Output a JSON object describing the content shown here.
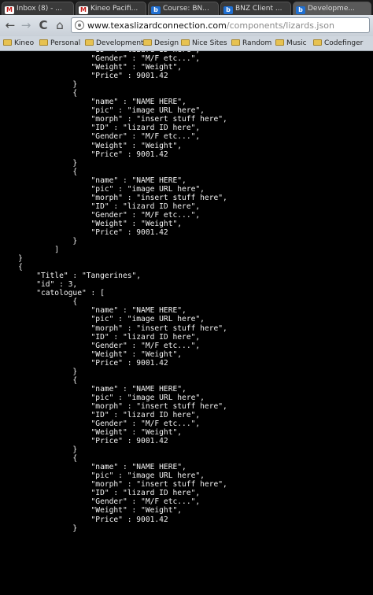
{
  "tabs": [
    {
      "title": "Inbox (8) - ...",
      "icon": "gmail-icon",
      "active": false
    },
    {
      "title": "Kineo Pacifi...",
      "icon": "gmail-icon",
      "active": false
    },
    {
      "title": "Course: BN...",
      "icon": "bookmark-b-icon",
      "active": false
    },
    {
      "title": "BNZ Client ...",
      "icon": "bookmark-b-icon",
      "active": false
    },
    {
      "title": "Developme...",
      "icon": "bookmark-b-icon",
      "active": true
    }
  ],
  "toolbar": {
    "back": "←",
    "forward": "→",
    "reload": "C",
    "home": "⌂",
    "url_host": "www.texaslizardconnection.com",
    "url_path": "/components/lizards.json"
  },
  "bookmarks": [
    "Kineo",
    "Personal",
    "Development",
    "Design",
    "Nice Sites",
    "Random",
    "Music",
    "Codefinger"
  ],
  "code": "                    \"ID\" : \"lizard ID here\",\n                    \"Gender\" : \"M/F etc...\",\n                    \"Weight\" : \"Weight\",\n                    \"Price\" : 9001.42\n                }\n                {\n                    \"name\" : \"NAME HERE\",\n                    \"pic\" : \"image URL here\",\n                    \"morph\" : \"insert stuff here\",\n                    \"ID\" : \"lizard ID here\",\n                    \"Gender\" : \"M/F etc...\",\n                    \"Weight\" : \"Weight\",\n                    \"Price\" : 9001.42\n                }\n                {\n                    \"name\" : \"NAME HERE\",\n                    \"pic\" : \"image URL here\",\n                    \"morph\" : \"insert stuff here\",\n                    \"ID\" : \"lizard ID here\",\n                    \"Gender\" : \"M/F etc...\",\n                    \"Weight\" : \"Weight\",\n                    \"Price\" : 9001.42\n                }\n            ]\n    }\n    {\n        \"Title\" : \"Tangerines\",\n        \"id\" : 3,\n        \"catologue\" : [\n                {\n                    \"name\" : \"NAME HERE\",\n                    \"pic\" : \"image URL here\",\n                    \"morph\" : \"insert stuff here\",\n                    \"ID\" : \"lizard ID here\",\n                    \"Gender\" : \"M/F etc...\",\n                    \"Weight\" : \"Weight\",\n                    \"Price\" : 9001.42\n                }\n                {\n                    \"name\" : \"NAME HERE\",\n                    \"pic\" : \"image URL here\",\n                    \"morph\" : \"insert stuff here\",\n                    \"ID\" : \"lizard ID here\",\n                    \"Gender\" : \"M/F etc...\",\n                    \"Weight\" : \"Weight\",\n                    \"Price\" : 9001.42\n                }\n                {\n                    \"name\" : \"NAME HERE\",\n                    \"pic\" : \"image URL here\",\n                    \"morph\" : \"insert stuff here\",\n                    \"ID\" : \"lizard ID here\",\n                    \"Gender\" : \"M/F etc...\",\n                    \"Weight\" : \"Weight\",\n                    \"Price\" : 9001.42\n                }",
  "colors": {
    "page_background": "#000000",
    "code_text": "#f2f2f2",
    "url_path": "#8a8a8a"
  }
}
